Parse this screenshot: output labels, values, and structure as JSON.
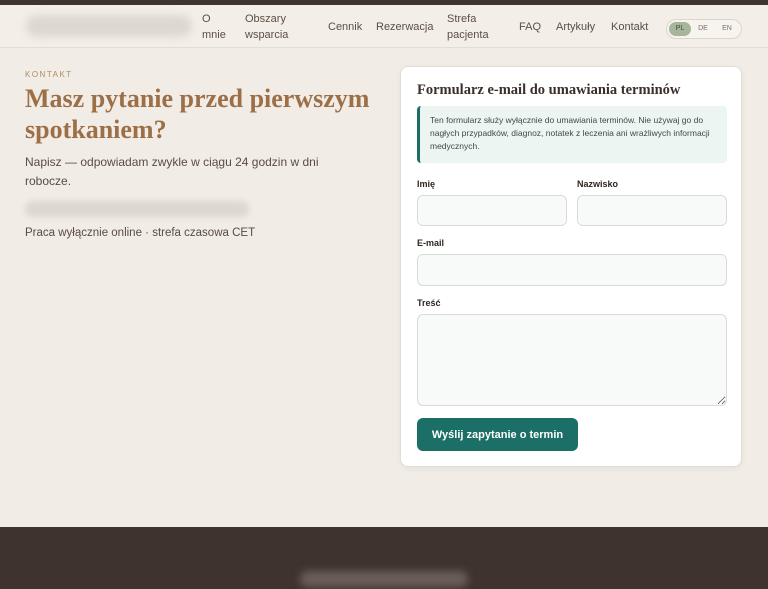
{
  "nav": {
    "items": [
      {
        "label": "O mnie",
        "lines": [
          "O",
          "mnie"
        ]
      },
      {
        "label": "Obszary wsparcia",
        "lines": [
          "Obszary",
          "wsparcia"
        ]
      },
      {
        "label": "Cennik",
        "lines": [
          "Cennik"
        ]
      },
      {
        "label": "Rezerwacja",
        "lines": [
          "Rezerwacja"
        ]
      },
      {
        "label": "Strefa pacjenta",
        "lines": [
          "Strefa",
          "pacjenta"
        ]
      },
      {
        "label": "FAQ",
        "lines": [
          "FAQ"
        ]
      },
      {
        "label": "Artykuły",
        "lines": [
          "Artykuły"
        ]
      },
      {
        "label": "Kontakt",
        "lines": [
          "Kontakt"
        ]
      }
    ]
  },
  "lang": {
    "pl": "PL",
    "de": "DE",
    "en": "EN",
    "active": "PL"
  },
  "intro": {
    "eyebrow": "KONTAKT",
    "title": "Masz pytanie przed pierwszym spotkaniem?",
    "subtitle": "Napisz — odpowiadam zwykle w ciągu 24 godzin w dni robocze.",
    "note": "Praca wyłącznie online · strefa czasowa CET"
  },
  "form": {
    "title": "Formularz e-mail do umawiania terminów",
    "info": "Ten formularz służy wyłącznie do umawiania terminów. Nie używaj go do nagłych przypadków, diagnoz, notatek z leczenia ani wrażliwych informacji medycznych.",
    "first_name_label": "Imię",
    "last_name_label": "Nazwisko",
    "email_label": "E-mail",
    "message_label": "Treść",
    "submit_label": "Wyślij zapytanie o termin"
  },
  "colors": {
    "accent": "#1b6f66",
    "heading": "#9c6f47",
    "footer": "#3f332e"
  }
}
